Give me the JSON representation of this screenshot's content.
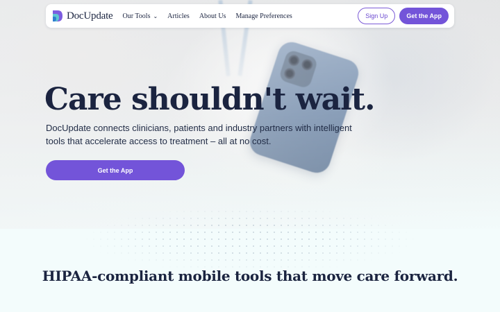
{
  "nav": {
    "brand": "DocUpdate",
    "links": [
      {
        "label": "Our Tools",
        "has_dropdown": true
      },
      {
        "label": "Articles",
        "has_dropdown": false
      },
      {
        "label": "About Us",
        "has_dropdown": false
      },
      {
        "label": "Manage Preferences",
        "has_dropdown": false
      }
    ],
    "signup_label": "Sign Up",
    "get_app_label": "Get the App"
  },
  "hero": {
    "title": "Care shouldn't wait.",
    "subtitle": "DocUpdate connects clinicians, patients and industry partners with intelligent tools that accelerate access to treatment – all at no cost.",
    "cta_label": "Get the App"
  },
  "features": {
    "heading": "HIPAA-compliant mobile tools that move care forward."
  },
  "icons": {
    "logo": "docupdate-logo-icon",
    "dropdown": "chevron-down-icon"
  },
  "colors": {
    "brand_purple": "#7354d9",
    "navy_text": "#1b2440",
    "page_bg": "#f3fcfc"
  }
}
